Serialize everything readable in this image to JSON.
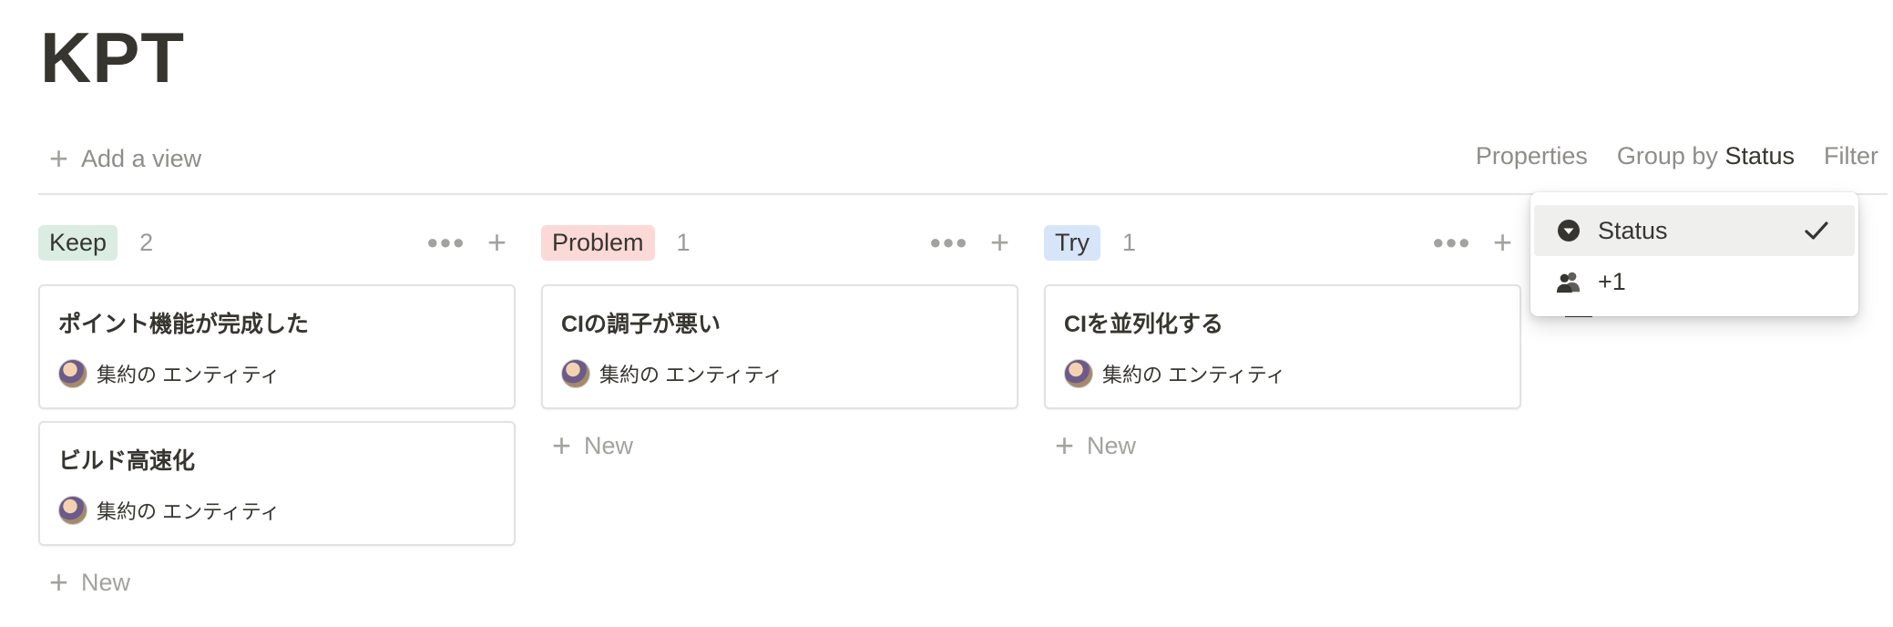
{
  "page": {
    "title": "KPT"
  },
  "toolbar": {
    "add_view_label": "Add a view",
    "properties_label": "Properties",
    "group_by_prefix": "Group by",
    "group_by_value": "Status",
    "filter_label": "Filter"
  },
  "columns": [
    {
      "tag": "Keep",
      "tag_color": "#dbede3",
      "count": "2",
      "cards": [
        {
          "title": "ポイント機能が完成した",
          "person": "集約の エンティティ"
        },
        {
          "title": "ビルド高速化",
          "person": "集約の エンティティ"
        }
      ],
      "new_label": "New"
    },
    {
      "tag": "Problem",
      "tag_color": "#fbd9d7",
      "count": "1",
      "cards": [
        {
          "title": "CIの調子が悪い",
          "person": "集約の エンティティ"
        }
      ],
      "new_label": "New"
    },
    {
      "tag": "Try",
      "tag_color": "#d7e5f8",
      "count": "1",
      "cards": [
        {
          "title": "CIを並列化する",
          "person": "集約の エンティティ"
        }
      ],
      "new_label": "New"
    }
  ],
  "group_by_menu": {
    "items": [
      {
        "label": "Status",
        "icon": "status-select-icon",
        "selected": true
      },
      {
        "label": "+1",
        "icon": "people-icon",
        "selected": false
      }
    ]
  },
  "colors": {
    "text": "#37352f",
    "muted": "#8f8d89",
    "keep": "#dbede3",
    "problem": "#fbd9d7",
    "try": "#d7e5f8"
  }
}
